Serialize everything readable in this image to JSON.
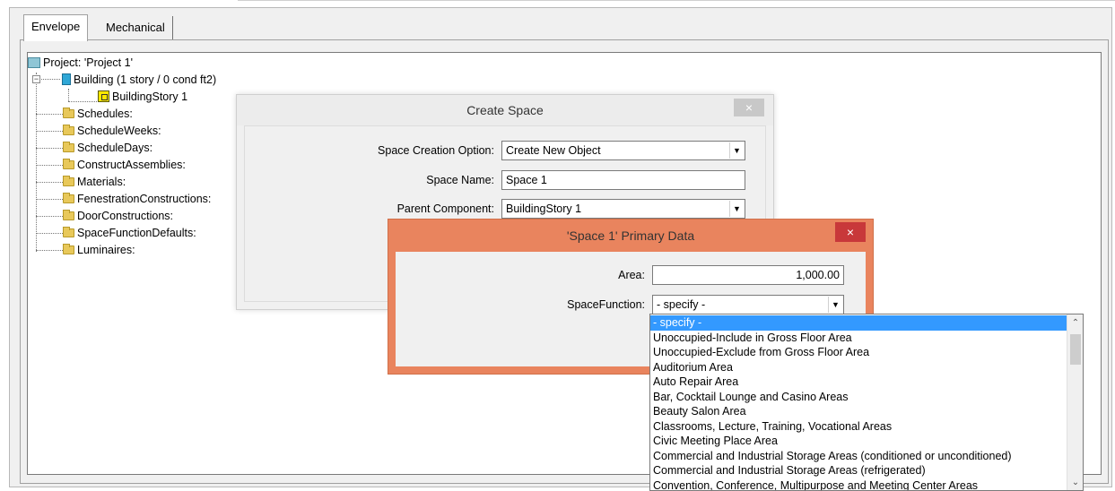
{
  "tabs": [
    {
      "label": "Envelope"
    },
    {
      "label": "Mechanical"
    }
  ],
  "tree": {
    "project": "Project:  'Project 1'",
    "building": "Building  (1 story / 0 cond ft2)",
    "building_story": "BuildingStory 1",
    "folders": [
      "Schedules:",
      "ScheduleWeeks:",
      "ScheduleDays:",
      "ConstructAssemblies:",
      "Materials:",
      "FenestrationConstructions:",
      "DoorConstructions:",
      "SpaceFunctionDefaults:",
      "Luminaires:"
    ]
  },
  "create_space": {
    "title": "Create Space",
    "close_label": "×",
    "creation_option_label": "Space Creation Option:",
    "creation_option_value": "Create New Object",
    "space_name_label": "Space Name:",
    "space_name_value": "Space 1",
    "parent_component_label": "Parent Component:",
    "parent_component_value": "BuildingStory 1"
  },
  "primary_data": {
    "title": "'Space 1' Primary Data",
    "close_label": "×",
    "area_label": "Area:",
    "area_value": "1,000.00",
    "space_function_label": "SpaceFunction:",
    "space_function_value": "- specify -"
  },
  "space_function_options": [
    "- specify -",
    "Unoccupied-Include in Gross Floor Area",
    "Unoccupied-Exclude from Gross Floor Area",
    "Auditorium Area",
    "Auto Repair Area",
    "Bar, Cocktail Lounge and Casino Areas",
    "Beauty Salon Area",
    "Classrooms, Lecture, Training, Vocational Areas",
    "Civic Meeting Place Area",
    "Commercial and Industrial Storage Areas (conditioned or unconditioned)",
    "Commercial and Industrial Storage Areas (refrigerated)",
    "Convention, Conference, Multipurpose and Meeting Center Areas"
  ],
  "colors": {
    "selection": "#3399ff",
    "primary_dialog_frame": "#e9845e",
    "close_red": "#c8383a"
  }
}
